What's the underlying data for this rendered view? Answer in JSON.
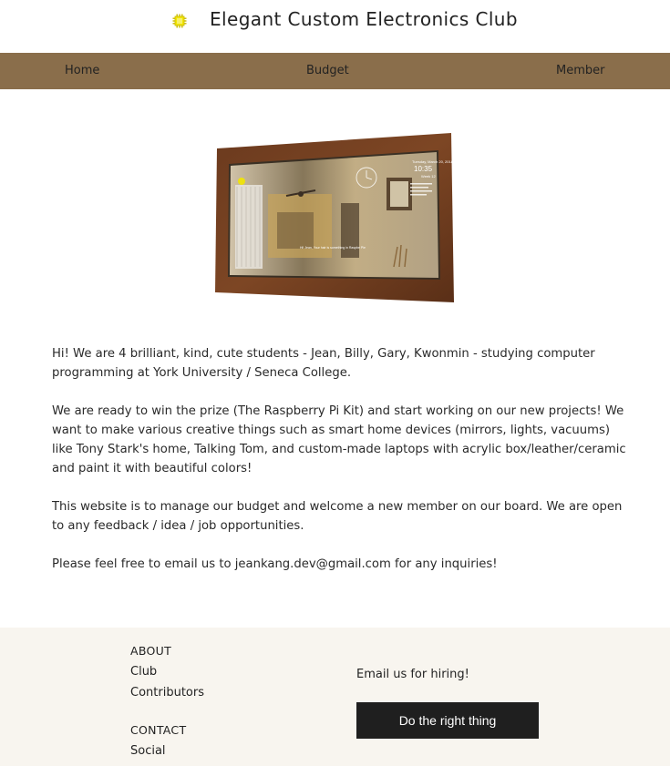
{
  "header": {
    "title": "Elegant Custom Electronics Club",
    "logo_icon": "chip-icon",
    "logo_color": "#f2e600"
  },
  "nav": {
    "items": [
      {
        "label": "Home"
      },
      {
        "label": "Budget"
      },
      {
        "label": "Member"
      }
    ],
    "background": "#8a6e4b"
  },
  "hero_image": {
    "subject": "wooden-framed smart mirror showing date, time and weather",
    "mirror_text": {
      "date": "Tuesday, March 20, 2018",
      "time": "10:35",
      "week": "Week 12",
      "caption": "Hi! Jean, Your hair is something in Raspbe Pie"
    }
  },
  "content": {
    "paragraphs": [
      "Hi! We are 4 brilliant, kind, cute students - Jean, Billy, Gary, Kwonmin - studying computer programming at York University / Seneca College.",
      "We are ready to win the prize (The Raspberry Pi Kit) and start working on our new projects! We want to make various creative things such as smart home devices (mirrors, lights, vacuums) like Tony Stark's home, Talking Tom, and custom-made laptops with acrylic box/leather/ceramic and paint it with beautiful colors!",
      "This website is to manage our budget and welcome a new member on our board. We are open to any feedback / idea / job opportunities.",
      "Please feel free to email us to jeankang.dev@gmail.com for any inquiries!"
    ]
  },
  "footer": {
    "about_heading": "ABOUT",
    "about_links": [
      "Club",
      "Contributors"
    ],
    "contact_heading": "CONTACT",
    "contact_links": [
      "Social"
    ],
    "hire_text": "Email us for hiring!",
    "cta_label": "Do the right thing",
    "background": "#f8f5ef"
  }
}
